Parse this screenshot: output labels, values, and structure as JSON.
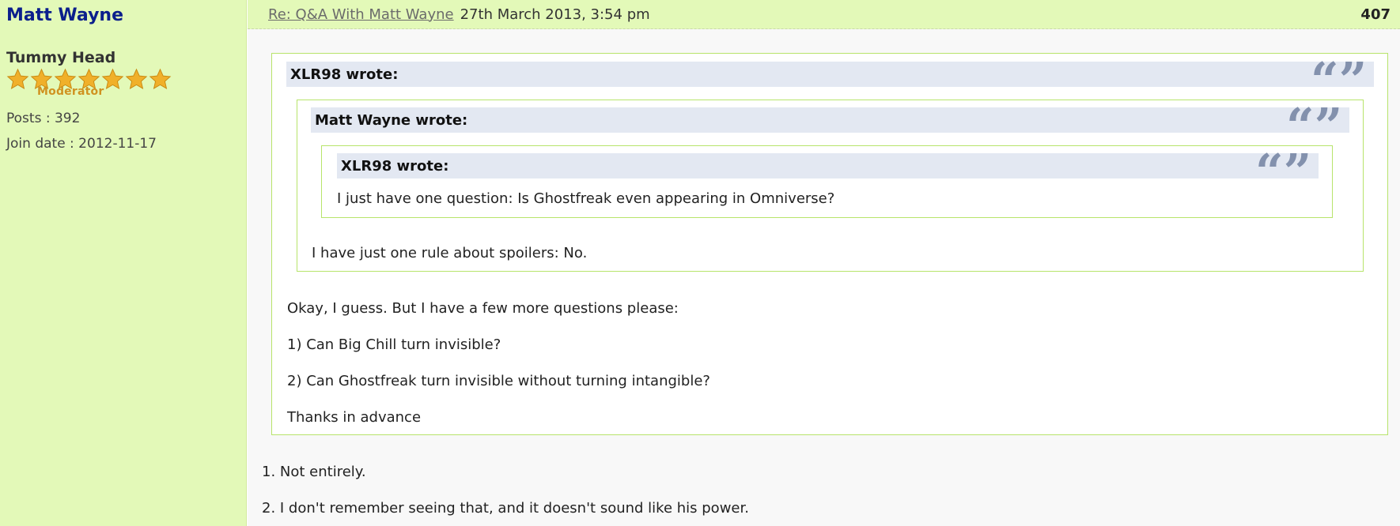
{
  "profile": {
    "username": "Matt Wayne",
    "rank_title": "Tummy Head",
    "star_count": 7,
    "rank_badge": "Moderator",
    "posts": "Posts : 392",
    "join_date": "Join date : 2012-11-17"
  },
  "post": {
    "title": "Re: Q&A With Matt Wayne",
    "date": "27th March 2013, 3:54 pm",
    "number": "407"
  },
  "quotes": {
    "outer": {
      "author": "XLR98 wrote:",
      "lines": [
        "Okay, I guess. But I have a few more questions please:",
        "1) Can Big Chill turn invisible?",
        "2) Can Ghostfreak turn invisible without turning intangible?",
        "Thanks in advance"
      ]
    },
    "middle": {
      "author": "Matt Wayne wrote:",
      "text": "I have just one rule about spoilers: No."
    },
    "inner": {
      "author": "XLR98 wrote:",
      "text": "I just have one question: Is Ghostfreak even appearing in Omniverse?"
    }
  },
  "reply": {
    "lines": [
      "1. Not entirely.",
      "2. I don't remember seeing that, and it doesn't sound like his power."
    ]
  },
  "colors": {
    "profile_bg": "#e3f9b8",
    "username": "#0b1f8c",
    "star": "#f0b02a",
    "quote_border": "#b7e46b",
    "quote_head_bg": "#e3e8f2",
    "quote_mark": "#8391ad"
  }
}
